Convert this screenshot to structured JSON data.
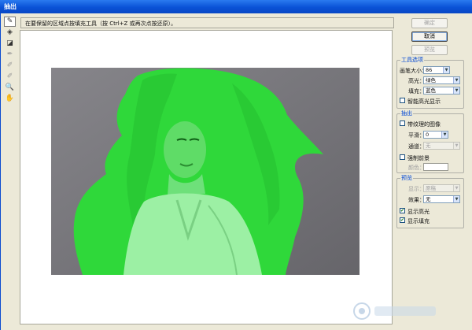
{
  "window": {
    "title": "抽出"
  },
  "tools": [
    {
      "name": "edge-highlighter-tool",
      "glyph": "✎",
      "active": true
    },
    {
      "name": "fill-tool",
      "glyph": "◈",
      "active": false
    },
    {
      "name": "eraser-tool",
      "glyph": "◪",
      "active": false
    },
    {
      "name": "eyedropper-tool",
      "glyph": "✒",
      "active": false,
      "dim": true
    },
    {
      "name": "cleanup-tool",
      "glyph": "✐",
      "active": false,
      "dim": true
    },
    {
      "name": "edge-touchup-tool",
      "glyph": "✐",
      "active": false,
      "dim": true
    },
    {
      "name": "zoom-tool",
      "glyph": "🔍",
      "active": false
    },
    {
      "name": "hand-tool",
      "glyph": "✋",
      "active": false
    }
  ],
  "instruction": "在要保留的区域点按填充工具（按 Ctrl+Z 或再次点按还原）。",
  "buttons": {
    "ok": "确定",
    "cancel": "取消",
    "preview": "预览"
  },
  "tool_options": {
    "title": "工具选项",
    "brush_size_label": "画笔大小：",
    "brush_size": "86",
    "highlight_label": "高光：",
    "highlight_value": "绿色",
    "fill_label": "填充：",
    "fill_value": "蓝色",
    "smart_highlight_label": "智能高光显示",
    "smart_highlight_checked": false
  },
  "extraction": {
    "title": "抽出",
    "textured_label": "带纹理的图像",
    "textured_checked": false,
    "smooth_label": "平滑：",
    "smooth_value": "0",
    "channel_label": "通道：",
    "channel_value": "无",
    "force_fg_label": "强制前景",
    "force_fg_checked": false,
    "color_label": "颜色："
  },
  "preview": {
    "title": "预览",
    "show_label": "显示：",
    "show_value": "原稿",
    "effect_label": "效果：",
    "effect_value": "无",
    "show_highlight_label": "显示高光",
    "show_highlight_checked": true,
    "show_fill_label": "显示填充",
    "show_fill_checked": true
  },
  "colors": {
    "highlight_green": "#33d93c",
    "photo_gray": "#7a797e",
    "title_blue": "#0a52d6"
  }
}
